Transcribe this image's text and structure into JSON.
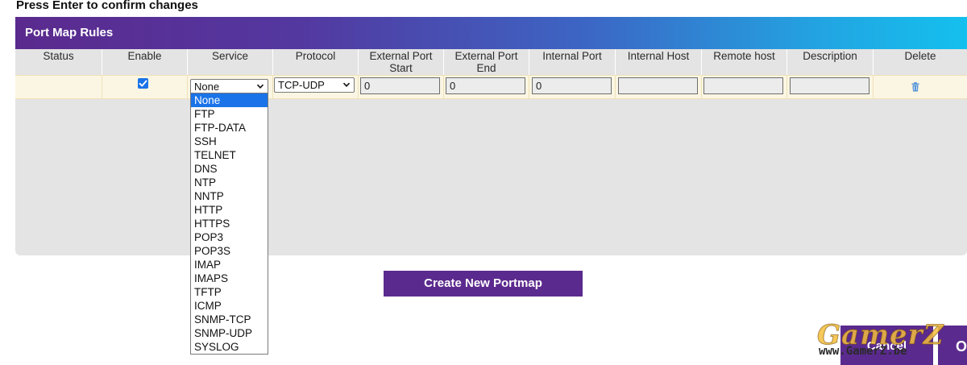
{
  "instruction": "Press Enter to confirm changes",
  "panel": {
    "title": "Port Map Rules",
    "columns": {
      "status": "Status",
      "enable": "Enable",
      "service": "Service",
      "protocol": "Protocol",
      "ext_start": "External Port Start",
      "ext_end": "External Port End",
      "internal_port": "Internal Port",
      "internal_host": "Internal Host",
      "remote_host": "Remote host",
      "description": "Description",
      "delete": "Delete"
    },
    "row": {
      "enabled": true,
      "service": "None",
      "protocol": "TCP-UDP",
      "ext_start": "0",
      "ext_end": "0",
      "internal_port": "0",
      "internal_host": "",
      "remote_host": "",
      "description": ""
    }
  },
  "service_options": [
    "None",
    "FTP",
    "FTP-DATA",
    "SSH",
    "TELNET",
    "DNS",
    "NTP",
    "NNTP",
    "HTTP",
    "HTTPS",
    "POP3",
    "POP3S",
    "IMAP",
    "IMAPS",
    "TFTP",
    "ICMP",
    "SNMP-TCP",
    "SNMP-UDP",
    "SYSLOG"
  ],
  "buttons": {
    "create": "Create New Portmap",
    "cancel": "Cancel",
    "ok": "O"
  },
  "watermark": {
    "logo": "GamerZ",
    "url": "www.GamerZ.be"
  },
  "colors": {
    "brand_purple": "#5b2a8e",
    "header_gradient_end": "#14c0ee",
    "selected_option": "#1a73e8"
  },
  "icons": {
    "enable_checkbox": "checkmark-icon",
    "service_select": "chevron-down-icon",
    "delete": "trash-icon"
  }
}
